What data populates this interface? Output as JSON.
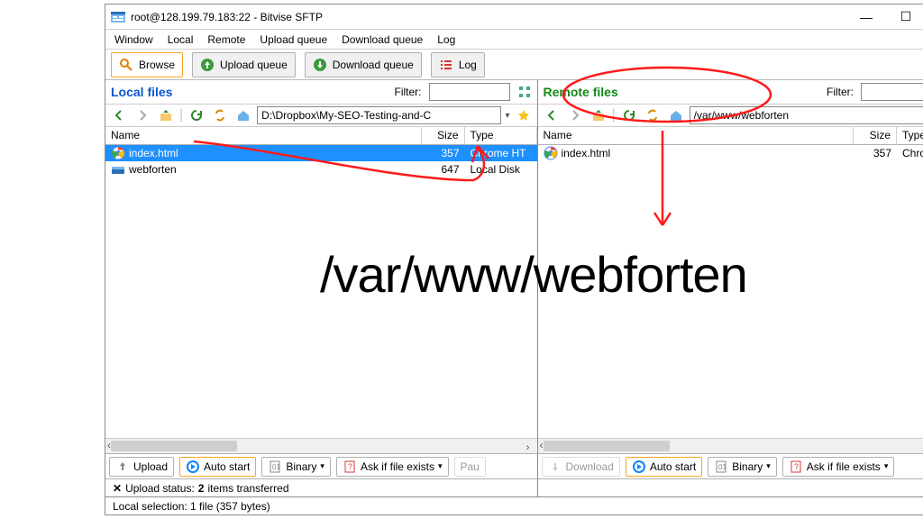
{
  "window": {
    "title": "root@128.199.79.183:22 - Bitvise SFTP",
    "menu": [
      "Window",
      "Local",
      "Remote",
      "Upload queue",
      "Download queue",
      "Log"
    ],
    "toolbar": {
      "browse": "Browse",
      "uploadq": "Upload queue",
      "downloadq": "Download queue",
      "log": "Log"
    }
  },
  "local": {
    "title": "Local files",
    "filter_label": "Filter:",
    "filter_value": "",
    "path": "D:\\Dropbox\\My-SEO-Testing-and-C",
    "columns": {
      "name": "Name",
      "size": "Size",
      "type": "Type"
    },
    "rows": [
      {
        "icon": "chrome",
        "name": "index.html",
        "size": "357",
        "type": "Chrome HT",
        "selected": true
      },
      {
        "icon": "folder-share",
        "name": "webforten",
        "size": "647",
        "type": "Local Disk",
        "selected": false
      }
    ],
    "footer": {
      "upload": "Upload",
      "auto_start": "Auto start",
      "binary": "Binary",
      "ask": "Ask if file exists",
      "pau": "Pau"
    }
  },
  "remote": {
    "title": "Remote files",
    "filter_label": "Filter:",
    "filter_value": "",
    "path": "/var/www/webforten",
    "columns": {
      "name": "Name",
      "size": "Size",
      "type": "Type"
    },
    "rows": [
      {
        "icon": "chrome",
        "name": "index.html",
        "size": "357",
        "type": "Chrome HT.",
        "selected": false
      }
    ],
    "footer": {
      "download": "Download",
      "auto_start": "Auto start",
      "binary": "Binary",
      "ask": "Ask if file exists"
    }
  },
  "status": {
    "upload_status_prefix": "Upload status:",
    "upload_status_count": "2",
    "upload_status_suffix": " items transferred",
    "selection": "Local selection: 1 file (357 bytes)"
  },
  "annotations": {
    "big_path_text": "/var/www/webforten"
  },
  "icons": {
    "browse": "search-icon",
    "uploadq": "up-arrow-icon",
    "downloadq": "down-arrow-icon",
    "log": "list-icon",
    "back": "back-icon",
    "fwd": "forward-icon",
    "up": "up-folder-icon",
    "refresh-left": "refresh-icon",
    "refresh-both": "refresh-both-icon",
    "home": "home-icon"
  }
}
